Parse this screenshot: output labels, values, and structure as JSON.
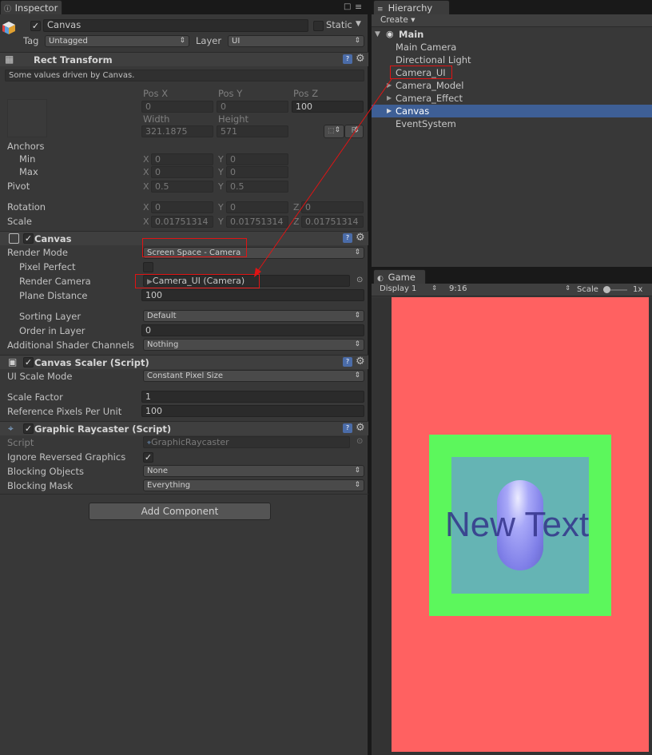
{
  "inspector": {
    "tab_label": "Inspector",
    "object_name": "Canvas",
    "static_label": "Static",
    "tag_label": "Tag",
    "tag_value": "Untagged",
    "layer_label": "Layer",
    "layer_value": "UI",
    "rect_transform": {
      "title": "Rect Transform",
      "driven_note": "Some values driven by Canvas.",
      "pos_x_label": "Pos X",
      "pos_y_label": "Pos Y",
      "pos_z_label": "Pos Z",
      "pos_x": "0",
      "pos_y": "0",
      "pos_z": "100",
      "width_label": "Width",
      "height_label": "Height",
      "width": "321.1875",
      "height": "571",
      "r_button": "R",
      "anchors_label": "Anchors",
      "min_label": "Min",
      "max_label": "Max",
      "min_x": "0",
      "min_y": "0",
      "max_x": "0",
      "max_y": "0",
      "pivot_label": "Pivot",
      "pivot_x": "0.5",
      "pivot_y": "0.5",
      "rotation_label": "Rotation",
      "rot_x": "0",
      "rot_y": "0",
      "rot_z": "0",
      "scale_label": "Scale",
      "scale_x": "0.01751314",
      "scale_y": "0.01751314",
      "scale_z": "0.01751314",
      "x": "X",
      "y": "Y",
      "z": "Z"
    },
    "canvas": {
      "title": "Canvas",
      "render_mode_label": "Render Mode",
      "render_mode": "Screen Space - Camera",
      "pixel_perfect_label": "Pixel Perfect",
      "render_camera_label": "Render Camera",
      "render_camera": "Camera_UI (Camera)",
      "plane_distance_label": "Plane Distance",
      "plane_distance": "100",
      "sorting_layer_label": "Sorting Layer",
      "sorting_layer": "Default",
      "order_label": "Order in Layer",
      "order": "0",
      "shader_channels_label": "Additional Shader Channels",
      "shader_channels": "Nothing"
    },
    "canvas_scaler": {
      "title": "Canvas Scaler (Script)",
      "ui_scale_mode_label": "UI Scale Mode",
      "ui_scale_mode": "Constant Pixel Size",
      "scale_factor_label": "Scale Factor",
      "scale_factor": "1",
      "ref_ppu_label": "Reference Pixels Per Unit",
      "ref_ppu": "100"
    },
    "raycaster": {
      "title": "Graphic Raycaster (Script)",
      "script_label": "Script",
      "script": "GraphicRaycaster",
      "ignore_reversed_label": "Ignore Reversed Graphics",
      "blocking_objects_label": "Blocking Objects",
      "blocking_objects": "None",
      "blocking_mask_label": "Blocking Mask",
      "blocking_mask": "Everything"
    },
    "add_component": "Add Component"
  },
  "hierarchy": {
    "tab_label": "Hierarchy",
    "create_label": "Create",
    "scene": "Main",
    "items": [
      "Main Camera",
      "Directional Light",
      "Camera_UI",
      "Camera_Model",
      "Camera_Effect",
      "Canvas",
      "EventSystem"
    ]
  },
  "game": {
    "tab_label": "Game",
    "display": "Display 1",
    "aspect": "9:16",
    "scale_label": "Scale",
    "scale_value": "1x",
    "text": "New Text"
  },
  "colors": {
    "game_bg": "#ff6161",
    "green_panel": "#5cf75c",
    "teal_panel": "#65b4b4",
    "capsule": "#9a9af5",
    "selection": "#3e5f96",
    "annotation": "#e01414"
  }
}
